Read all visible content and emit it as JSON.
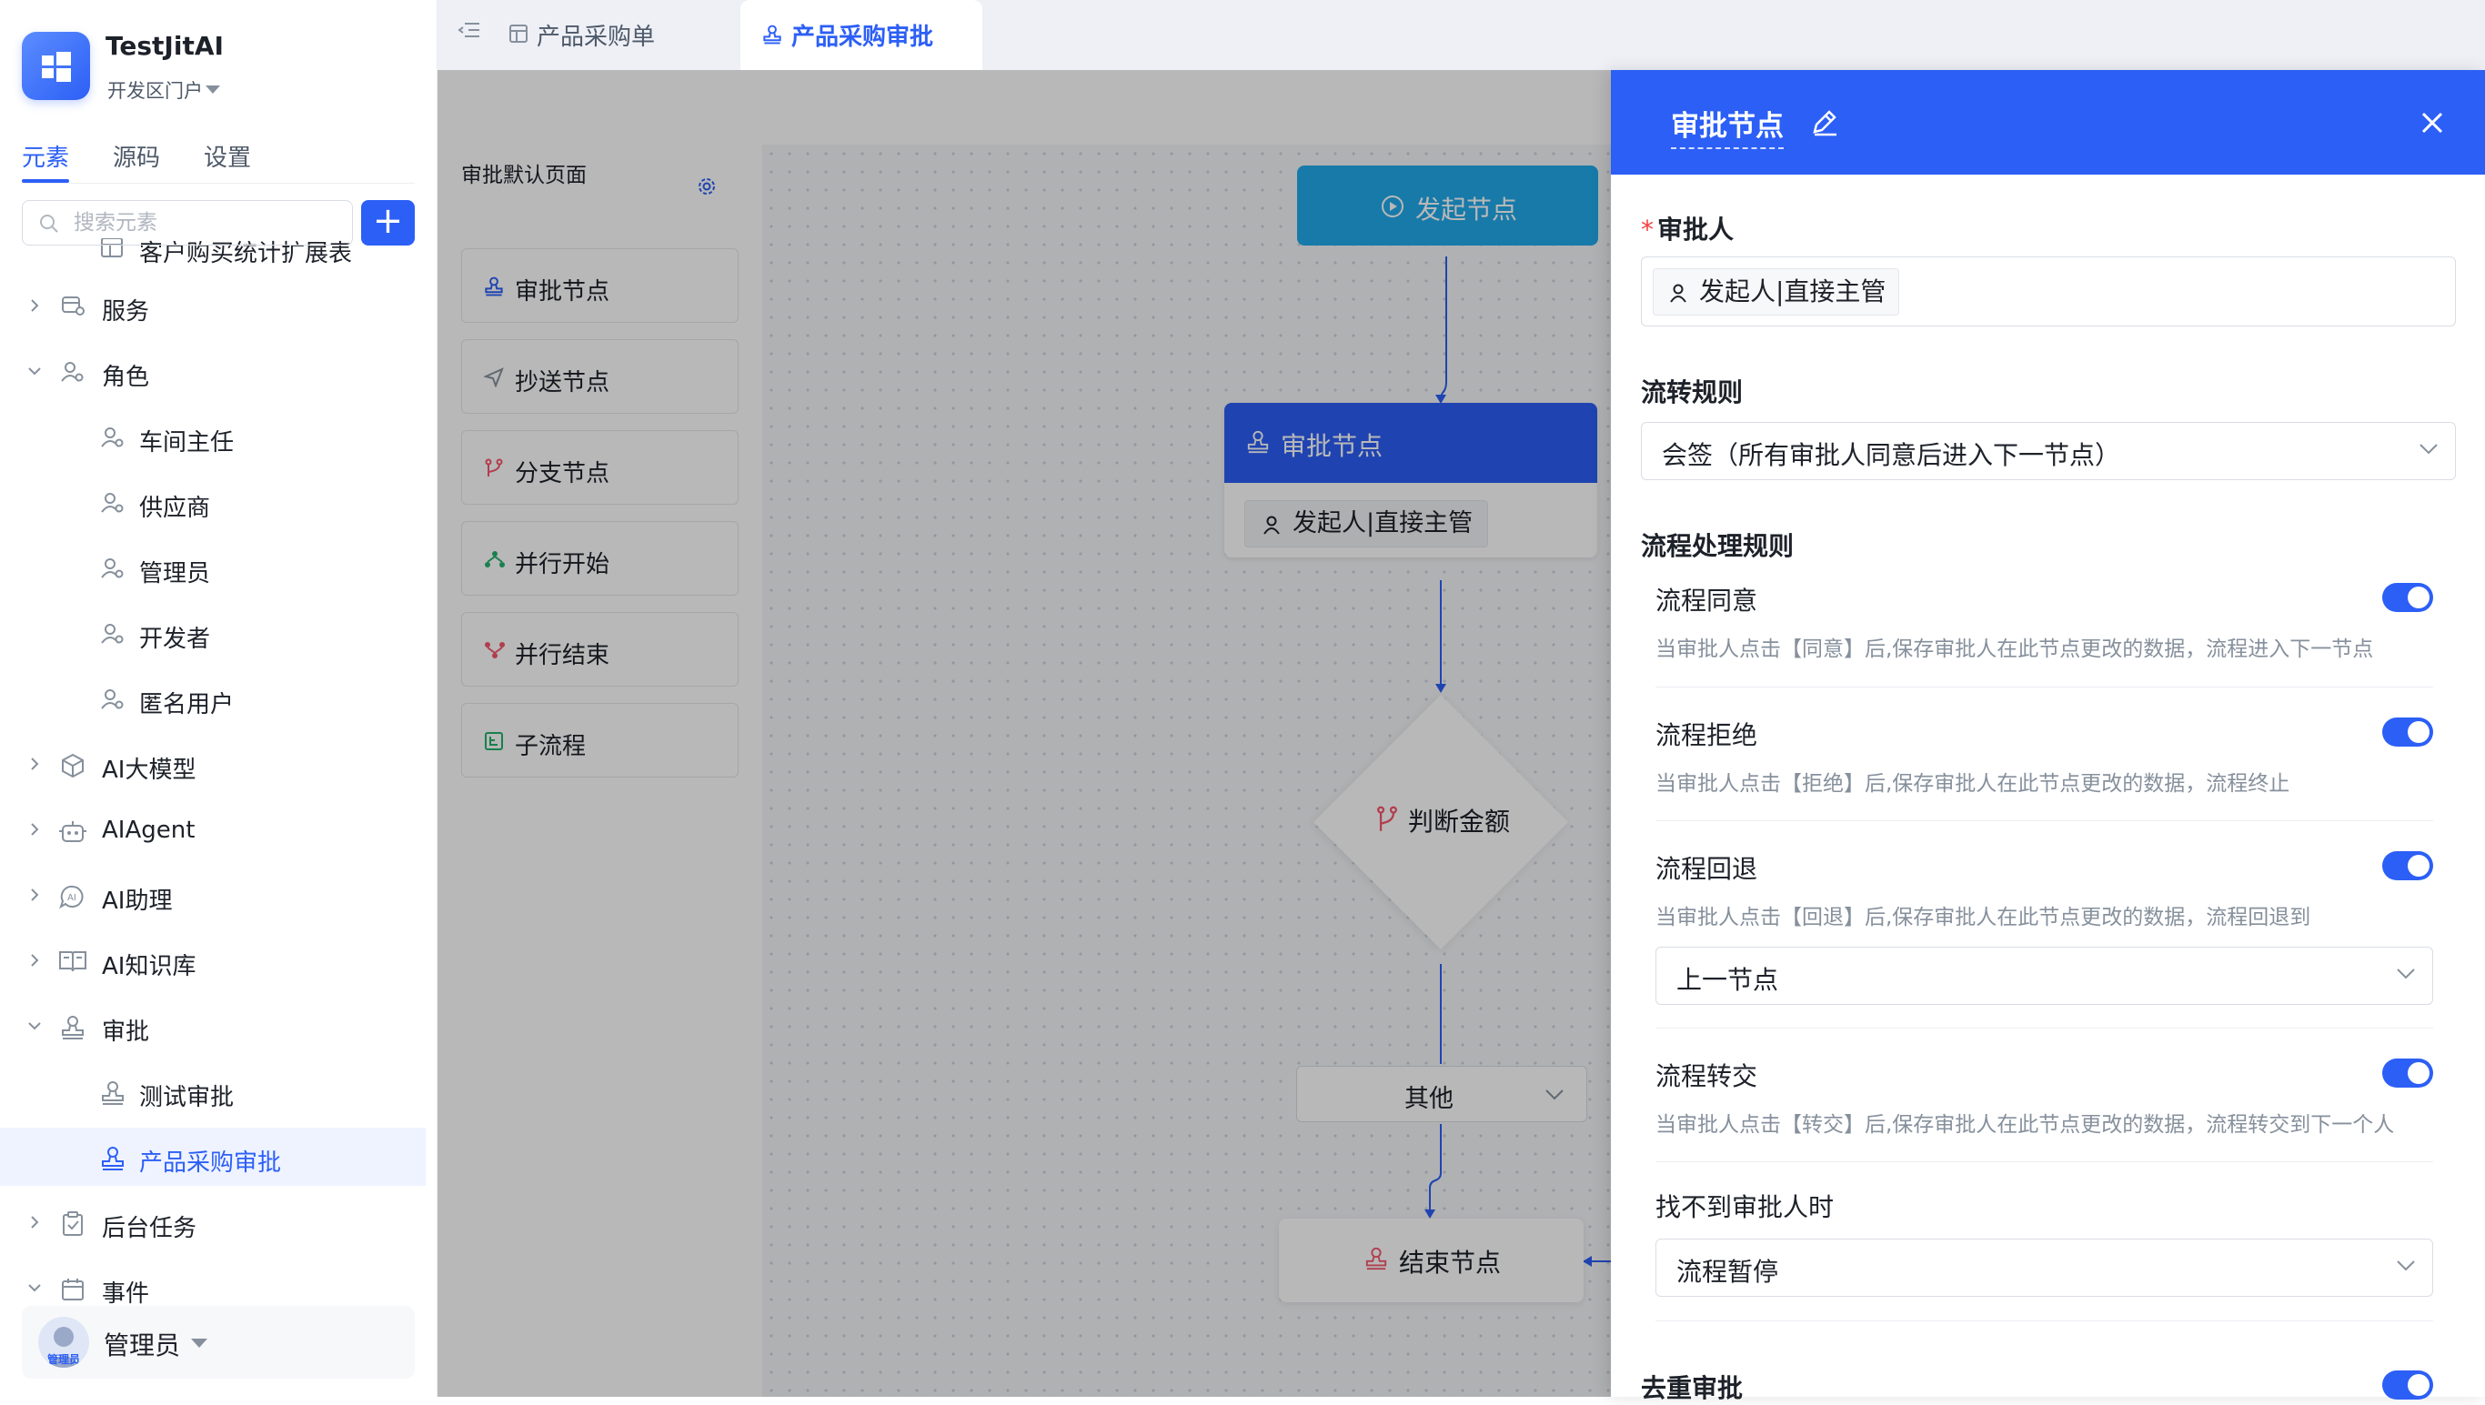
{
  "app": {
    "name": "TestJitAI",
    "portal": "开发区门户"
  },
  "sidebar": {
    "tabs": [
      {
        "label": "元素",
        "active": true
      },
      {
        "label": "源码"
      },
      {
        "label": "设置"
      }
    ],
    "search_placeholder": "搜索元素",
    "add_label": "+",
    "tree": [
      {
        "label": "客户购买统计扩展表",
        "level": 1,
        "icon": "table-icon"
      },
      {
        "label": "服务",
        "level": 0,
        "icon": "service-icon",
        "expanded": false
      },
      {
        "label": "角色",
        "level": 0,
        "icon": "role-icon",
        "expanded": true
      },
      {
        "label": "车间主任",
        "level": 1,
        "icon": "role-icon"
      },
      {
        "label": "供应商",
        "level": 1,
        "icon": "role-icon"
      },
      {
        "label": "管理员",
        "level": 1,
        "icon": "role-icon"
      },
      {
        "label": "开发者",
        "level": 1,
        "icon": "role-icon"
      },
      {
        "label": "匿名用户",
        "level": 1,
        "icon": "role-icon"
      },
      {
        "label": "AI大模型",
        "level": 0,
        "icon": "cube-icon",
        "expanded": false
      },
      {
        "label": "AIAgent",
        "level": 0,
        "icon": "robot-icon",
        "expanded": false
      },
      {
        "label": "AI助理",
        "level": 0,
        "icon": "ai-assistant-icon",
        "expanded": false
      },
      {
        "label": "AI知识库",
        "level": 0,
        "icon": "book-icon",
        "expanded": false
      },
      {
        "label": "审批",
        "level": 0,
        "icon": "stamp-icon",
        "expanded": true
      },
      {
        "label": "测试审批",
        "level": 1,
        "icon": "stamp-icon"
      },
      {
        "label": "产品采购审批",
        "level": 1,
        "icon": "stamp-icon",
        "selected": true
      },
      {
        "label": "后台任务",
        "level": 0,
        "icon": "task-icon",
        "expanded": false
      },
      {
        "label": "事件",
        "level": 0,
        "icon": "event-icon",
        "expanded": true
      }
    ],
    "user": {
      "name": "管理员",
      "avatar_text": "管理员"
    }
  },
  "topbar": {
    "tabs": [
      {
        "label": "产品采购单",
        "icon": "table-icon",
        "active": false
      },
      {
        "label": "产品采购审批",
        "icon": "stamp-icon",
        "active": true
      }
    ]
  },
  "palette": {
    "header": "审批默认页面",
    "items": [
      {
        "label": "审批节点",
        "icon": "stamp-icon",
        "color": "#2c5ff6"
      },
      {
        "label": "抄送节点",
        "icon": "send-icon",
        "color": "#86909c"
      },
      {
        "label": "分支节点",
        "icon": "branch-icon",
        "color": "#f5576c"
      },
      {
        "label": "并行开始",
        "icon": "parallel-start-icon",
        "color": "#23b26d"
      },
      {
        "label": "并行结束",
        "icon": "parallel-end-icon",
        "color": "#f5576c"
      },
      {
        "label": "子流程",
        "icon": "subprocess-icon",
        "color": "#23b26d"
      }
    ]
  },
  "flow": {
    "start_label": "发起节点",
    "approve_label": "审批节点",
    "approve_chip": "发起人|直接主管",
    "branch_label": "判断金额",
    "branch_option": "其他",
    "end_label": "结束节点"
  },
  "panel": {
    "title": "审批节点",
    "approver_label": "审批人",
    "approver_value": "发起人|直接主管",
    "flow_rule_label": "流转规则",
    "flow_rule_value": "会签（所有审批人同意后进入下一节点）",
    "handling_label": "流程处理规则",
    "rules": [
      {
        "title": "流程同意",
        "desc": "当审批人点击【同意】后,保存审批人在此节点更改的数据，流程进入下一节点",
        "enabled": true
      },
      {
        "title": "流程拒绝",
        "desc": "当审批人点击【拒绝】后,保存审批人在此节点更改的数据，流程终止",
        "enabled": true
      },
      {
        "title": "流程回退",
        "desc": "当审批人点击【回退】后,保存审批人在此节点更改的数据，流程回退到",
        "enabled": true,
        "select": "上一节点"
      },
      {
        "title": "流程转交",
        "desc": "当审批人点击【转交】后,保存审批人在此节点更改的数据，流程转交到下一个人",
        "enabled": true
      }
    ],
    "no_approver_label": "找不到审批人时",
    "no_approver_value": "流程暂停",
    "dedupe_label": "去重审批",
    "dedupe_enabled": true
  },
  "colors": {
    "primary": "#2c5ff6",
    "start_node": "#21a9ea",
    "danger": "#f53f3f"
  }
}
